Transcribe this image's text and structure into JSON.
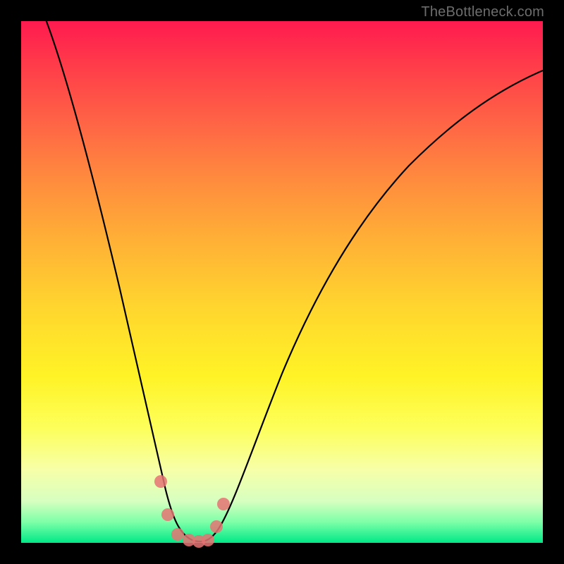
{
  "watermark": "TheBottleneck.com",
  "colors": {
    "frame": "#000000",
    "curve": "#000000",
    "marker": "#e57373",
    "gradient_top": "#ff1a4f",
    "gradient_bottom": "#00e887"
  },
  "chart_data": {
    "type": "line",
    "title": "",
    "xlabel": "",
    "ylabel": "",
    "xlim": [
      0,
      100
    ],
    "ylim": [
      0,
      102
    ],
    "grid": false,
    "legend": false,
    "x": [
      4,
      6,
      8,
      10,
      12,
      14,
      16,
      18,
      20,
      22,
      24,
      26,
      28.5,
      30,
      32,
      34,
      35.5,
      37,
      39,
      42,
      46,
      50,
      54,
      58,
      62,
      66,
      70,
      74,
      78,
      82,
      86,
      90,
      94,
      98,
      100
    ],
    "y": [
      102,
      98,
      93,
      88,
      82,
      76,
      70,
      63,
      56,
      48,
      38,
      27,
      12,
      4,
      1,
      0,
      0,
      2,
      8,
      18,
      28,
      36,
      43,
      49,
      55,
      60,
      64,
      68,
      71,
      74,
      76.5,
      78.5,
      80,
      81,
      81.5
    ],
    "markers": {
      "x": [
        26,
        27.5,
        29.5,
        31.5,
        33.5,
        35.5,
        37,
        38.5
      ],
      "y": [
        12,
        5,
        1,
        0,
        0,
        0,
        3,
        8
      ]
    },
    "annotations": []
  }
}
